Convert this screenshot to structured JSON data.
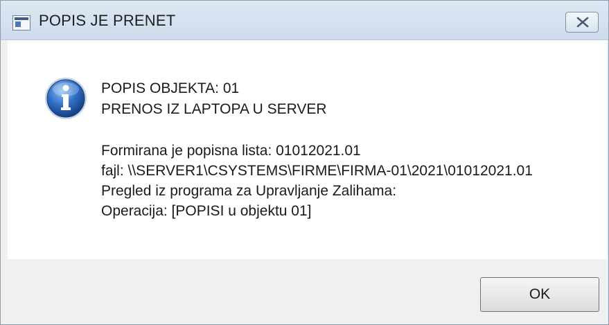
{
  "window": {
    "title": "POPIS JE PRENET",
    "icon": "application-window-icon",
    "close_icon": "close-icon"
  },
  "message": {
    "icon": "information-icon",
    "line1": "POPIS OBJEKTA: 01",
    "line2": "PRENOS IZ LAPTOPA U SERVER",
    "line3": "Formirana je popisna lista: 01012021.01",
    "line4": "fajl: \\\\SERVER1\\CSYSTEMS\\FIRME\\FIRMA-01\\2021\\01012021.01",
    "line5": "Pregled iz programa za Upravljanje Zalihama:",
    "line6": "Operacija: [POPISI u objektu 01]"
  },
  "buttons": {
    "ok_label": "OK"
  },
  "colors": {
    "titlebar": "#ccdbea",
    "info_blue": "#2a5aa8",
    "button_area": "#f0f0f0"
  }
}
